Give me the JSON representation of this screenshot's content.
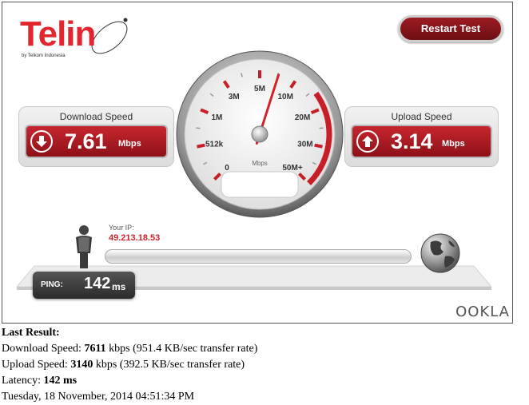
{
  "logo": {
    "name": "Telin",
    "sub": "by Telkom Indonesia"
  },
  "restart_label": "Restart Test",
  "download": {
    "title": "Download Speed",
    "value": "7.61",
    "unit": "Mbps"
  },
  "upload": {
    "title": "Upload Speed",
    "value": "3.14",
    "unit": "Mbps"
  },
  "gauge": {
    "ticks": [
      "0",
      "512k",
      "1M",
      "3M",
      "5M",
      "10M",
      "20M",
      "30M",
      "50M+"
    ],
    "unit": "Mbps",
    "needle_value_mbps": 7.61
  },
  "ip": {
    "label": "Your IP:",
    "value": "49.213.18.53"
  },
  "ping": {
    "label": "PING:",
    "value": "142",
    "unit": "ms"
  },
  "brand": "OOKLA",
  "results": {
    "heading": "Last Result:",
    "download_prefix": "Download Speed: ",
    "download_kbps": "7611",
    "download_suffix": " kbps (951.4 KB/sec transfer rate)",
    "upload_prefix": "Upload Speed: ",
    "upload_kbps": "3140",
    "upload_suffix": " kbps (392.5 KB/sec transfer rate)",
    "latency_prefix": "Latency: ",
    "latency_ms": "142 ms",
    "timestamp": "Tuesday, 18 November, 2014 04:51:34 PM"
  },
  "colors": {
    "accent": "#d1232b",
    "dark_red": "#8e1018"
  }
}
